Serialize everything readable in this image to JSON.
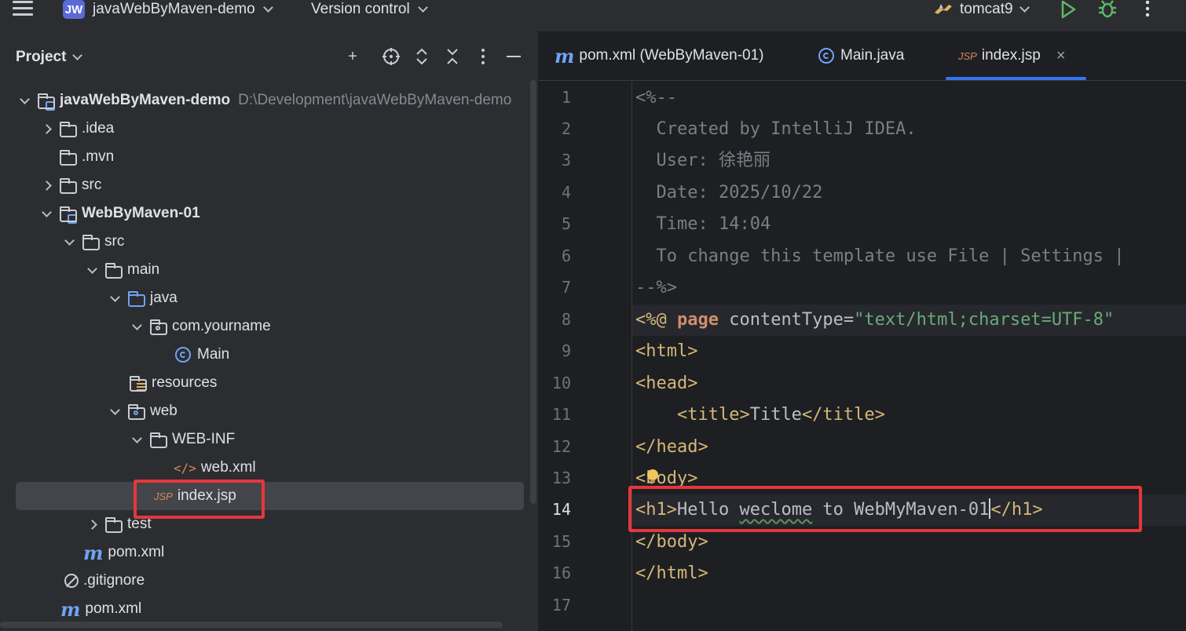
{
  "topbar": {
    "project_badge": "JW",
    "project_name": "javaWebByMaven-demo",
    "vcs_label": "Version control",
    "run_config": "tomcat9"
  },
  "project_panel": {
    "title": "Project",
    "tree": [
      {
        "label": "javaWebByMaven-demo",
        "hint": "D:\\Development\\javaWebByMaven-demo",
        "depth": 0,
        "expanded": true,
        "icon": "module-folder-icon"
      },
      {
        "label": ".idea",
        "depth": 1,
        "expanded": false,
        "icon": "folder-icon"
      },
      {
        "label": ".mvn",
        "depth": 1,
        "icon": "folder-icon"
      },
      {
        "label": "src",
        "depth": 1,
        "expanded": false,
        "icon": "folder-icon"
      },
      {
        "label": "WebByMaven-01",
        "depth": 1,
        "expanded": true,
        "icon": "module-folder-icon"
      },
      {
        "label": "src",
        "depth": 2,
        "expanded": true,
        "icon": "folder-icon"
      },
      {
        "label": "main",
        "depth": 3,
        "expanded": true,
        "icon": "folder-icon"
      },
      {
        "label": "java",
        "depth": 4,
        "expanded": true,
        "icon": "source-folder-icon"
      },
      {
        "label": "com.yourname",
        "depth": 5,
        "expanded": true,
        "icon": "package-icon"
      },
      {
        "label": "Main",
        "depth": 6,
        "icon": "java-class-icon"
      },
      {
        "label": "resources",
        "depth": 4,
        "icon": "resources-folder-icon"
      },
      {
        "label": "web",
        "depth": 4,
        "expanded": true,
        "icon": "web-folder-icon"
      },
      {
        "label": "WEB-INF",
        "depth": 5,
        "expanded": true,
        "icon": "folder-icon"
      },
      {
        "label": "web.xml",
        "depth": 6,
        "icon": "xml-icon"
      },
      {
        "label": "index.jsp",
        "depth": 5,
        "icon": "jsp-icon",
        "selected": true
      },
      {
        "label": "test",
        "depth": 3,
        "expanded": false,
        "icon": "folder-icon"
      },
      {
        "label": "pom.xml",
        "depth": 2,
        "icon": "maven-icon"
      },
      {
        "label": ".gitignore",
        "depth": 1,
        "icon": "ignore-icon"
      },
      {
        "label": "pom.xml",
        "depth": 1,
        "icon": "maven-icon"
      }
    ]
  },
  "editor": {
    "tabs": [
      {
        "label": "pom.xml (WebByMaven-01)",
        "icon": "maven-icon"
      },
      {
        "label": "Main.java",
        "icon": "java-class-icon"
      },
      {
        "label": "index.jsp",
        "icon": "jsp-icon",
        "active": true
      }
    ],
    "icon_labels": {
      "jsp": "JSP",
      "maven": "m",
      "xml": "</>",
      "close": "×"
    },
    "line_numbers": [
      "1",
      "2",
      "3",
      "4",
      "5",
      "6",
      "7",
      "8",
      "9",
      "10",
      "11",
      "12",
      "13",
      "14",
      "15",
      "16",
      "17"
    ],
    "current_line": "14",
    "code": {
      "l1": "<%--",
      "l2": "  Created by IntelliJ IDEA.",
      "l3": "  User: 徐艳丽",
      "l4": "  Date: 2025/10/22",
      "l5": "  Time: 14:04",
      "l6": "  To change this template use File | Settings |",
      "l7": "--%>",
      "l8_open": "<%@ ",
      "l8_kw": "page",
      "l8_attr": " contentType=",
      "l8_str": "\"text/html;charset=UTF-8\"",
      "l9": "<html>",
      "l10": "<head>",
      "l11_indent": "    ",
      "l11_open": "<title>",
      "l11_text": "Title",
      "l11_close": "</title>",
      "l12": "</head>",
      "l13": "<body>",
      "l14_open": "<h1>",
      "l14_t1": "Hello ",
      "l14_wavy": "weclome",
      "l14_t2": " to WebMyMaven-01",
      "l14_close": "</h1>",
      "l15": "</body>",
      "l16": "</html>"
    }
  },
  "colors": {
    "highlight_box": "#e5373c",
    "accent": "#3574f0",
    "jsp_tag": "#d5b778",
    "string": "#6aab73",
    "keyword": "#cf8e6d",
    "comment": "#7a7e85"
  }
}
